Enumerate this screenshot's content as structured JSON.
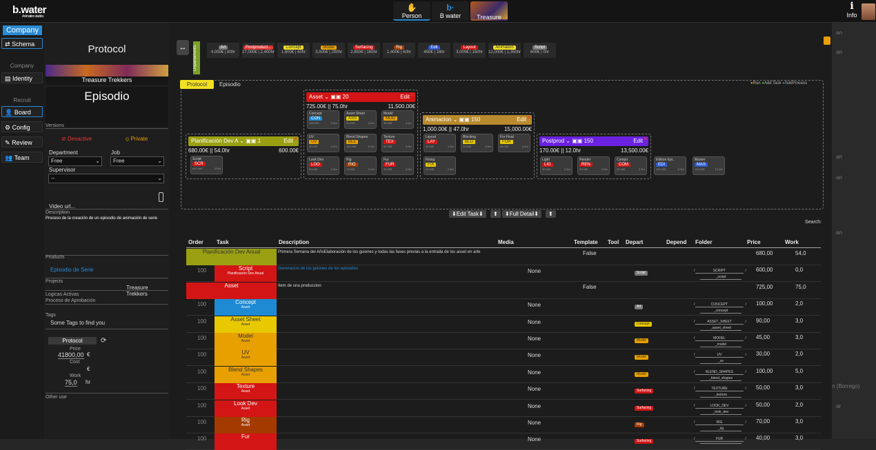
{
  "app": {
    "logo": "b.water",
    "logo_sub": "Animation studios"
  },
  "top_tabs": [
    {
      "label": "Person",
      "icon": "hand-icon"
    },
    {
      "label": "B water",
      "icon": "bwater-icon"
    },
    {
      "label": "Treasure",
      "icon": "treasure-image"
    }
  ],
  "info_label": "Info",
  "left_nav": {
    "company": "Company",
    "schema": "Schema",
    "sec_company": "Company",
    "identity": "Identity",
    "sec_recruit": "Recruit",
    "board": "Board",
    "config": "Config",
    "review": "Review",
    "team": "Team"
  },
  "protocol_panel": {
    "title": "Protocol",
    "banner_name": "Treasure Trekkers",
    "episode": "Episodio",
    "versions_label": "Versions",
    "desactive": "Desactive",
    "private": "Private",
    "department_label": "Department",
    "department_value": "Free",
    "job_label": "Job",
    "job_value": "Free",
    "supervisor_label": "Supervisor",
    "supervisor_value": "--",
    "video_label": "Video url...",
    "description_label": "Description",
    "description": "Proceso de la creación de un episodio de animación de serie",
    "products_label": "Products",
    "product": "Episodio de Serie",
    "projects_label": "Projects",
    "project": "Treasure Trekkers",
    "logicas": "Logicas Activas",
    "proceso": "Proceso de Aprobación",
    "tags_label": "Tags",
    "tags_placeholder": "Some Tags to find you",
    "proto_btn": "Protocol",
    "price_label": "Price",
    "price_value": "41800,00",
    "currency": "€",
    "cost_label": "Cost",
    "work_label": "Work",
    "work_value": "75,0",
    "hr": "hr",
    "other_use": "Other use"
  },
  "colors": {
    "accent": "#2a8ad4",
    "yellow": "#f2e021",
    "asset_red": "#d31515",
    "anim_gold": "#b98a2d",
    "postprod_purple": "#6a22e0"
  },
  "departments": [
    {
      "tag": "Art",
      "color": "#777",
      "info": "4,000€ | 80hr"
    },
    {
      "tag": "Postproduct...",
      "color": "#d33",
      "info": "27,000€ | 2,400hr"
    },
    {
      "tag": "Concept",
      "color": "#f2e021",
      "info": "1,800€ | 60hr"
    },
    {
      "tag": "Model",
      "color": "#e8a000",
      "info": "3,500€ | 200hr"
    },
    {
      "tag": "Surfacing",
      "color": "#d31515",
      "info": "2,850€ | 160hr"
    },
    {
      "tag": "Rig",
      "color": "#a43a00",
      "info": "1,400€ | 60hr"
    },
    {
      "tag": "Edit",
      "color": "#2a5ad4",
      "info": "450€ | 16hr"
    },
    {
      "tag": "Layout",
      "color": "#d31515",
      "info": "3,000€ | 150hr"
    },
    {
      "tag": "Animation",
      "color": "#f2e021",
      "info": "12,000€ | 1,350hr"
    },
    {
      "tag": "Script",
      "color": "#777",
      "info": "600€ | 0hr"
    }
  ],
  "dept_vertical_label": "Departaments",
  "board": {
    "tab_protocol": "Protocol",
    "tab_episodio": "Episodio",
    "run": "Run",
    "add_task": "Add Task",
    "subprocess": "SubProcess",
    "groups": [
      {
        "name": "Planificación Dev A",
        "count": "1",
        "edit": "Edit",
        "left": "680.00€ || 54.0hr",
        "right": "600.00€",
        "color": "#9aa012"
      },
      {
        "name": "Asset",
        "count": "20",
        "edit": "Edit",
        "left": "725.00€ || 75.0hr",
        "right": "11,500.00€",
        "color": "#d31515"
      },
      {
        "name": "Animacion",
        "count": "150",
        "edit": "Edit",
        "left": "1,000.00€ || 47.0hr",
        "right": "15,000.00€",
        "color": "#b98a2d"
      },
      {
        "name": "Postprod",
        "count": "150",
        "edit": "Edit",
        "left": "170.00€ || 12.0hr",
        "right": "13,500.00€",
        "color": "#6a22e0"
      }
    ],
    "tasks": [
      {
        "title": "Script",
        "abbr": "SCR",
        "color": "#d31515",
        "foot": "600.00€",
        "hr": "0.0hr"
      },
      {
        "title": "Concept",
        "abbr": "CON",
        "color": "#1e8ad4",
        "foot": "100.00€",
        "hr": "2.0hr"
      },
      {
        "title": "Asset Sheet",
        "abbr": "ASS",
        "color": "#e8c800",
        "foot": "90.00€",
        "hr": "3.0hr"
      },
      {
        "title": "Model",
        "abbr": "MOD",
        "color": "#e8a000",
        "foot": "45.00€",
        "hr": "3.0hr"
      },
      {
        "title": "UV",
        "abbr": "UV",
        "color": "#e8a000",
        "foot": "30.00€",
        "hr": "2.0hr"
      },
      {
        "title": "Blend Shapes",
        "abbr": "BLE",
        "color": "#e8a000",
        "foot": "100.00€",
        "hr": "5.0hr"
      },
      {
        "title": "Texture",
        "abbr": "TEX",
        "color": "#d31515",
        "foot": "50.00€",
        "hr": "3.0hr"
      },
      {
        "title": "Look Dev",
        "abbr": "LOO",
        "color": "#d31515",
        "foot": "50.00€",
        "hr": "2.0hr"
      },
      {
        "title": "Rig",
        "abbr": "RIG",
        "color": "#a43a00",
        "foot": "70.00€",
        "hr": "3.0hr"
      },
      {
        "title": "Fur",
        "abbr": "FUR",
        "color": "#d31515",
        "foot": "40.00€",
        "hr": "3.0hr"
      },
      {
        "title": "Layout",
        "abbr": "LAY",
        "color": "#d31515",
        "foot": "30.00€",
        "hr": "1.0hr"
      },
      {
        "title": "Blocking",
        "abbr": "BLO",
        "color": "#e8c800",
        "foot": "30.00€",
        "hr": "4.0hr"
      },
      {
        "title": "For Final",
        "abbr": "FOR",
        "color": "#e8c800",
        "foot": "40.00€",
        "hr": "4.0hr"
      },
      {
        "title": "Fixing",
        "abbr": "FIX",
        "color": "#e8c800",
        "foot": "10.00€",
        "hr": "1.0hr"
      },
      {
        "title": "Light",
        "abbr": "LIG",
        "color": "#d31515",
        "foot": "30.00€",
        "hr": "2.0hr"
      },
      {
        "title": "Render",
        "abbr": "REN",
        "color": "#d31515",
        "foot": "20.00€",
        "hr": "4.0hr"
      },
      {
        "title": "Compo",
        "abbr": "COM",
        "color": "#d31515",
        "foot": "20.00€",
        "hr": "2.0hr"
      },
      {
        "title": "Edition Epi...",
        "abbr": "EDI",
        "color": "#2a5ad4",
        "foot": "100.00€",
        "hr": "6.0hr"
      },
      {
        "title": "Master",
        "abbr": "MAS",
        "color": "#2a5ad4",
        "foot": "100.00€",
        "hr": "10.0hr"
      }
    ]
  },
  "toolbar": {
    "edit_task": "Edit Task",
    "full_detail": "Full Detail",
    "search": "Search:"
  },
  "table": {
    "headers": [
      "Order",
      "Task",
      "Description",
      "Media",
      "Template",
      "Tool",
      "Depart",
      "Depend",
      "Folder",
      "Price",
      "Work"
    ],
    "rows": [
      {
        "order": "",
        "task": "Planificación Dev Anual",
        "sub": "",
        "color": "#9aa012",
        "desc": "Primera Semana del AñoElaboración de los guiones y todas las fases previas a la entrada de los asset en arte",
        "media": "",
        "template": "False",
        "dept": "",
        "dcolor": "",
        "folder": "",
        "folder2": "",
        "price": "680,00",
        "work": "54,0"
      },
      {
        "order": "100",
        "task": "Script",
        "sub": "Planificación Dev Anual",
        "color": "#d31515",
        "desc": "Generacion de los guiones de los episodios",
        "media": "None",
        "template": "",
        "dept": "Script",
        "dcolor": "#777",
        "folder": "SCRIPT",
        "folder2": "_script",
        "price": "600,00",
        "work": "0,0"
      },
      {
        "order": "",
        "task": "Asset",
        "sub": "",
        "color": "#d31515",
        "desc": "Item de una produccion",
        "media": "",
        "template": "False",
        "dept": "",
        "dcolor": "",
        "folder": "",
        "folder2": "",
        "price": "725,00",
        "work": "75,0"
      },
      {
        "order": "100",
        "task": "Concept",
        "sub": "Asset",
        "color": "#1e8ad4",
        "desc": "",
        "media": "None",
        "template": "",
        "dept": "Art",
        "dcolor": "#777",
        "folder": "CONCEPT",
        "folder2": "_concept",
        "price": "100,00",
        "work": "2,0"
      },
      {
        "order": "100",
        "task": "Asset Sheet",
        "sub": "Asset",
        "color": "#e8c800",
        "desc": "",
        "media": "None",
        "template": "",
        "dept": "Concept",
        "dcolor": "#e8c800",
        "folder": "ASSET_SHEET",
        "folder2": "_asset_sheet",
        "price": "90,00",
        "work": "3,0"
      },
      {
        "order": "100",
        "task": "Model",
        "sub": "Asset",
        "color": "#e8a000",
        "desc": "",
        "media": "None",
        "template": "",
        "dept": "Model",
        "dcolor": "#e8a000",
        "folder": "MODEL",
        "folder2": "_model",
        "price": "45,00",
        "work": "3,0"
      },
      {
        "order": "100",
        "task": "UV",
        "sub": "Asset",
        "color": "#e8a000",
        "desc": "",
        "media": "None",
        "template": "",
        "dept": "Model",
        "dcolor": "#e8a000",
        "folder": "UV",
        "folder2": "_uv",
        "price": "30,00",
        "work": "2,0"
      },
      {
        "order": "100",
        "task": "Blend Shapes",
        "sub": "Asset",
        "color": "#e8a000",
        "desc": "",
        "media": "None",
        "template": "",
        "dept": "Model",
        "dcolor": "#e8a000",
        "folder": "BLEND_SHAPES",
        "folder2": "_blend_shapes",
        "price": "100,00",
        "work": "5,0"
      },
      {
        "order": "100",
        "task": "Texture",
        "sub": "Asset",
        "color": "#d31515",
        "desc": "",
        "media": "None",
        "template": "",
        "dept": "Surfacing",
        "dcolor": "#d31515",
        "folder": "TEXTURE",
        "folder2": "_texture",
        "price": "50,00",
        "work": "3,0"
      },
      {
        "order": "100",
        "task": "Look Dev",
        "sub": "Asset",
        "color": "#d31515",
        "desc": "",
        "media": "None",
        "template": "",
        "dept": "Surfacing",
        "dcolor": "#d31515",
        "folder": "LOOK_DEV",
        "folder2": "_look_dev",
        "price": "50,00",
        "work": "2,0"
      },
      {
        "order": "100",
        "task": "Rig",
        "sub": "Asset",
        "color": "#a43a00",
        "desc": "",
        "media": "None",
        "template": "",
        "dept": "Rig",
        "dcolor": "#a43a00",
        "folder": "RIG",
        "folder2": "_rig",
        "price": "70,00",
        "work": "3,0"
      },
      {
        "order": "100",
        "task": "Fur",
        "sub": "",
        "color": "#d31515",
        "desc": "",
        "media": "None",
        "template": "",
        "dept": "Surfacing",
        "dcolor": "#d31515",
        "folder": "FUR",
        "folder2": "",
        "price": "40,00",
        "work": "3,0"
      }
    ]
  },
  "right_strip": [
    "an",
    "an",
    "an",
    "an",
    "an",
    "n (Borrego)",
    "ar"
  ]
}
